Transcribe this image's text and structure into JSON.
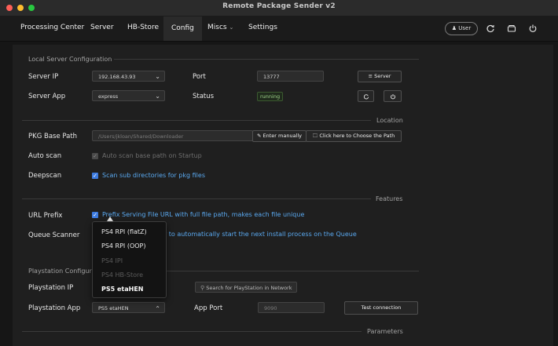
{
  "window": {
    "title": "Remote Package Sender v2"
  },
  "menu": {
    "items": [
      "Processing Center",
      "Server",
      "HB-Store",
      "Config",
      "Miscs",
      "Settings"
    ],
    "user_label": "User"
  },
  "local_server": {
    "section_title": "Local Server Configuration",
    "server_ip_label": "Server IP",
    "server_ip_value": "192.168.43.93",
    "port_label": "Port",
    "port_value": "13777",
    "server_button": "Server",
    "server_app_label": "Server App",
    "server_app_value": "express",
    "status_label": "Status",
    "status_value": "running"
  },
  "location": {
    "section_title": "Location",
    "pkg_label": "PKG Base Path",
    "pkg_value": "/Users/jkloan/Shared/Downloader",
    "enter_manually": "Enter manually",
    "choose_path": "Click here to Choose the Path",
    "autoscan_label": "Auto scan",
    "autoscan_text": "Auto scan base path on Startup",
    "deepscan_label": "Deepscan",
    "deepscan_text": "Scan sub directories for pkg files"
  },
  "features": {
    "section_title": "Features",
    "url_prefix_label": "URL Prefix",
    "url_prefix_text": "Prefix Serving File URL with full file path, makes each file unique",
    "queue_label": "Queue Scanner",
    "queue_text": "er to automatically start the next install process on the Queue"
  },
  "playstation": {
    "section_title": "Playstation Configura",
    "ip_label": "Playstation IP",
    "search_placeholder": "Search for PlayStation in Network",
    "app_label": "Playstation App",
    "app_value": "PS5 etaHEN",
    "app_port_label": "App Port",
    "app_port_value": "9090",
    "test_button": "Test connection"
  },
  "dropdown": {
    "items": [
      "PS4 RPI (flatZ)",
      "PS4 RPI (OOP)",
      "PS4 IPI",
      "PS4 HB-Store",
      "PS5 etaHEN"
    ]
  },
  "parameters": {
    "section_title": "Parameters"
  },
  "colors": {
    "accent": "#3d7be0",
    "link": "#5aa9f0",
    "status_ok": "#9fd48a"
  }
}
